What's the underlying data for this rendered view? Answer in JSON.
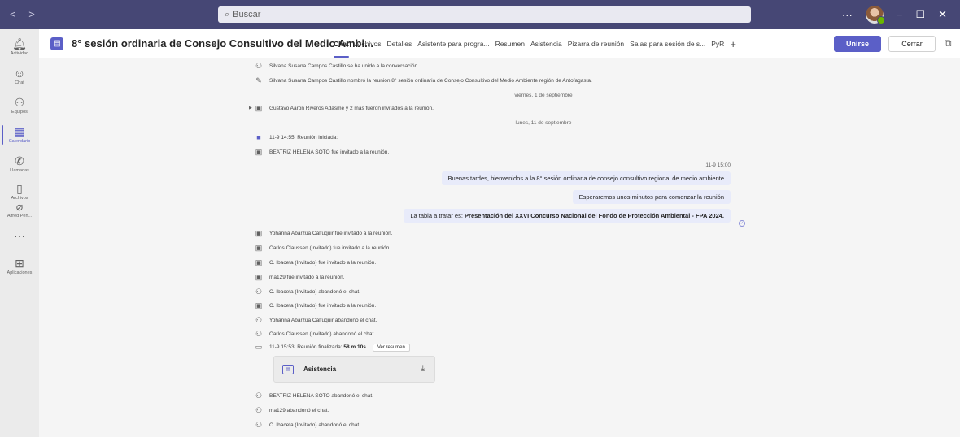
{
  "titlebar": {
    "nav": "< >",
    "search_placeholder": "Buscar",
    "more": "···",
    "minimize": "−",
    "maximize": "☐",
    "close": "✕"
  },
  "rail": [
    {
      "label": "Actividad",
      "icon": "bell-icon",
      "glyph": "🔔︎",
      "active": false
    },
    {
      "label": "Chat",
      "icon": "chat-icon",
      "glyph": "☺",
      "active": false
    },
    {
      "label": "Equipos",
      "icon": "teams-icon",
      "glyph": "⚇",
      "active": false
    },
    {
      "label": "Calendario",
      "icon": "calendar-icon",
      "glyph": "▦",
      "active": true
    },
    {
      "label": "Llamadas",
      "icon": "phone-icon",
      "glyph": "✆",
      "active": false
    },
    {
      "label": "Archivos",
      "icon": "file-icon",
      "glyph": "▯",
      "active": false
    },
    {
      "label": "Alfred Pen...",
      "icon": "app-icon",
      "glyph": "⌀",
      "active": false
    },
    {
      "label": "",
      "icon": "more-icon",
      "glyph": "···",
      "active": false
    },
    {
      "label": "Aplicaciones",
      "icon": "apps-icon",
      "glyph": "⊞",
      "active": false
    }
  ],
  "header": {
    "title": "8° sesión ordinaria de Consejo Consultivo del Medio Ambi...",
    "tabs": [
      "Chat",
      "Archivos",
      "Detalles",
      "Asistente para progra...",
      "Resumen",
      "Asistencia",
      "Pizarra de reunión",
      "Salas para sesión de s...",
      "PyR"
    ],
    "add_tab": "+",
    "join": "Unirse",
    "close": "Cerrar"
  },
  "events_top": [
    {
      "icon": "person-join-icon",
      "glyph": "⚇",
      "text": "Silvana Susana Campos Castillo se ha unido a la conversación."
    },
    {
      "icon": "pencil-icon",
      "glyph": "✎",
      "text": "Silvana Susana Campos Castillo nombró la reunión 8° sesión ordinaria de Consejo Consultivo del Medio Ambiente región de Antofagasta."
    }
  ],
  "date1": "viernes, 1 de septiembre",
  "invited_group": "Gustavo Aaron Riveros Adasme y 2 más fueron invitados a la reunión.",
  "date2": "lunes, 11 de septiembre",
  "meeting_started": {
    "time": "11-9 14:55",
    "text": "Reunión iniciada:"
  },
  "invited_beatriz": "BEATRIZ HELENA SOTO fue invitado a la reunión.",
  "messages": {
    "timestamp": "11-9 15:00",
    "m1": "Buenas tardes, bienvenidos a la 8° sesión ordinaria de consejo consultivo regional de medio ambiente",
    "m2": "Esperaremos unos minutos para comenzar la reunión",
    "m3_prefix": "La tabla a tratar es: ",
    "m3_bold": "Presentación del XXVI Concurso Nacional del Fondo de Protección Ambiental - FPA 2024."
  },
  "events_mid": [
    {
      "icon": "calendar-add-icon",
      "glyph": "▣",
      "text": "Yohanna Abarzúa Calfuquir fue invitado a la reunión."
    },
    {
      "icon": "calendar-add-icon",
      "glyph": "▣",
      "text": "Carlos Claussen (Invitado) fue invitado a la reunión."
    },
    {
      "icon": "calendar-add-icon",
      "glyph": "▣",
      "text": "C. Ibaceta (Invitado) fue invitado a la reunión."
    },
    {
      "icon": "calendar-add-icon",
      "glyph": "▣",
      "text": "ma129 fue invitado a la reunión."
    },
    {
      "icon": "person-leave-icon",
      "glyph": "⚇",
      "text": "C. Ibaceta (Invitado) abandonó el chat."
    },
    {
      "icon": "calendar-add-icon",
      "glyph": "▣",
      "text": "C. Ibaceta (Invitado) fue invitado a la reunión."
    },
    {
      "icon": "person-leave-icon",
      "glyph": "⚇",
      "text": "Yohanna Abarzúa Calfuquir abandonó el chat."
    },
    {
      "icon": "person-leave-icon",
      "glyph": "⚇",
      "text": "Carlos Claussen (Invitado) abandonó el chat."
    }
  ],
  "meeting_ended": {
    "time": "11-9 15:53",
    "label": "Reunión finalizada:",
    "duration": "58 m 10s",
    "button": "Ver resumen"
  },
  "attachment": {
    "name": "Asistencia"
  },
  "events_bottom": [
    {
      "icon": "person-leave-icon",
      "glyph": "⚇",
      "text": "BEATRIZ HELENA SOTO abandonó el chat."
    },
    {
      "icon": "person-leave-icon",
      "glyph": "⚇",
      "text": "ma129 abandonó el chat."
    },
    {
      "icon": "person-leave-icon",
      "glyph": "⚇",
      "text": "C. Ibaceta (Invitado) abandonó el chat."
    }
  ]
}
